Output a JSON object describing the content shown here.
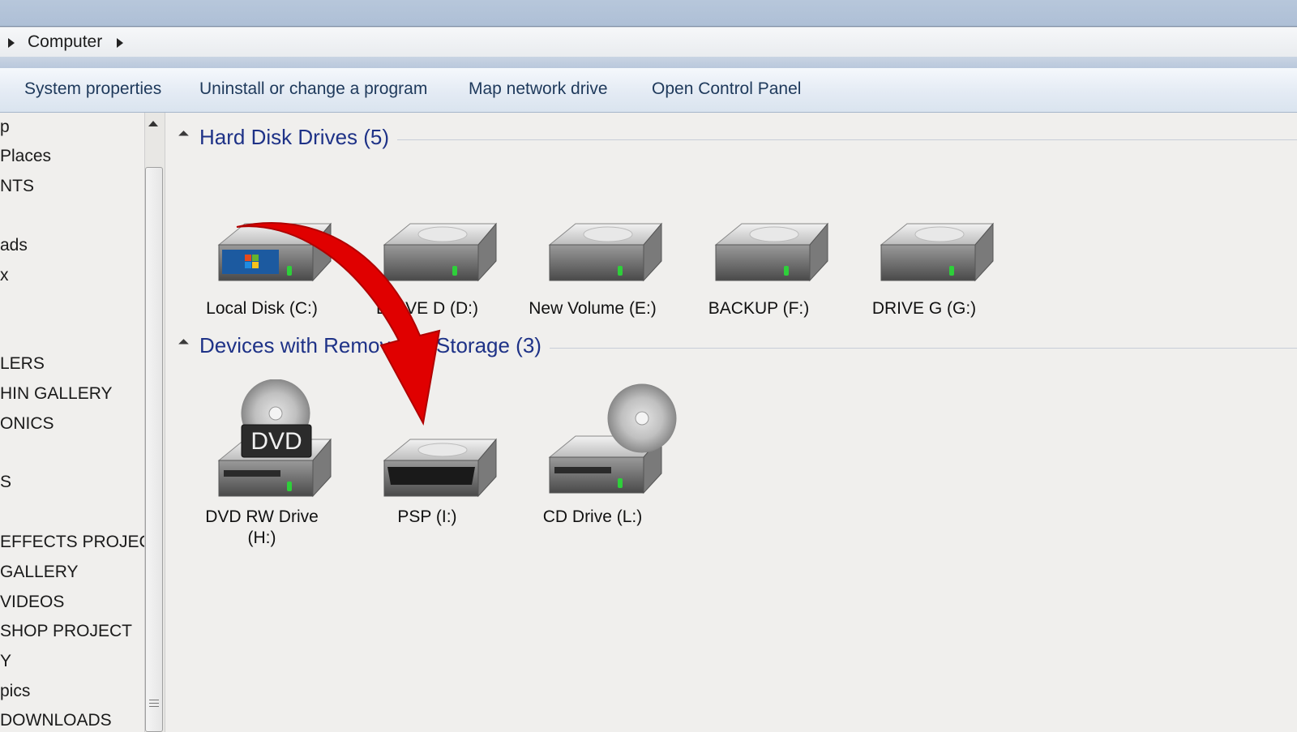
{
  "address": {
    "location": "Computer"
  },
  "command_bar": {
    "system_properties": "System properties",
    "uninstall": "Uninstall or change a program",
    "map_network": "Map network drive",
    "control_panel": "Open Control Panel"
  },
  "nav": {
    "items": [
      "p",
      "Places",
      "NTS",
      "",
      "ads",
      "x",
      "",
      "",
      "LERS",
      "HIN GALLERY",
      "ONICS",
      "",
      "S",
      "",
      "EFFECTS PROJECTS",
      "GALLERY",
      "VIDEOS",
      "SHOP PROJECT",
      "Y",
      "pics",
      "DOWNLOADS"
    ]
  },
  "groups": {
    "hard_disks": {
      "title": "Hard Disk Drives (5)",
      "drives": [
        "Local Disk (C:)",
        "DRIVE D (D:)",
        "New Volume (E:)",
        "BACKUP (F:)",
        "DRIVE G (G:)"
      ]
    },
    "removable": {
      "title": "Devices with Removable Storage (3)",
      "drives": [
        "DVD RW Drive (H:)",
        "PSP (I:)",
        "CD Drive (L:)"
      ]
    }
  },
  "icons": {
    "dvd_badge": "DVD"
  },
  "colors": {
    "group_title": "#1e3287",
    "annotation_arrow": "#e00000"
  }
}
